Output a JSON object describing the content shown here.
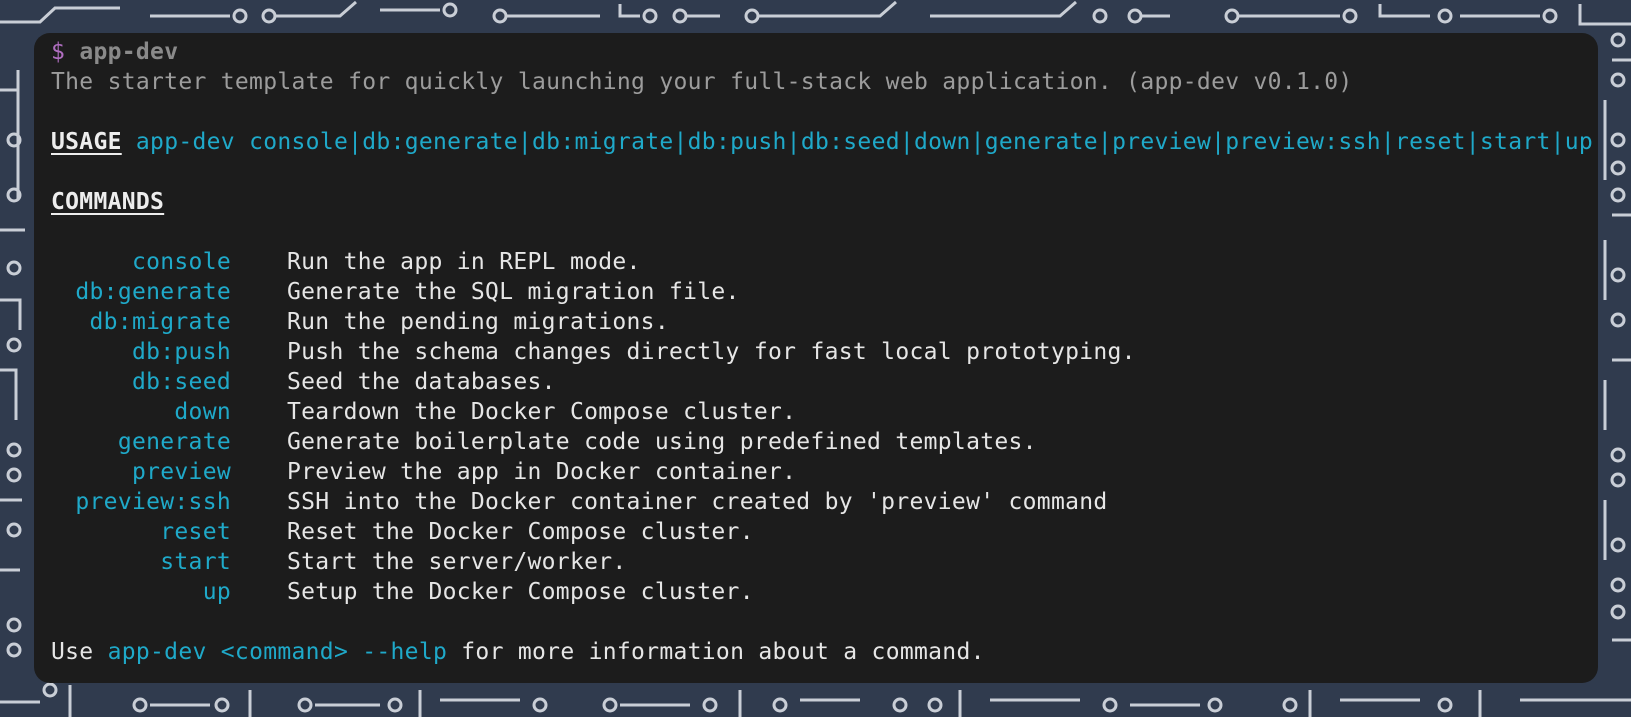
{
  "prompt": {
    "symbol": "$",
    "command": "app-dev"
  },
  "description": "The starter template for quickly launching your full-stack web application. (app-dev v0.1.0)",
  "usage": {
    "keyword": "USAGE",
    "binary": "app-dev",
    "subcommands": "console|db:generate|db:migrate|db:push|db:seed|down|generate|preview|preview:ssh|reset|start|up"
  },
  "commands": {
    "heading": "COMMANDS",
    "items": [
      {
        "name": "console",
        "desc": "Run the app in REPL mode."
      },
      {
        "name": "db:generate",
        "desc": "Generate the SQL migration file."
      },
      {
        "name": "db:migrate",
        "desc": "Run the pending migrations."
      },
      {
        "name": "db:push",
        "desc": "Push the schema changes directly for fast local prototyping."
      },
      {
        "name": "db:seed",
        "desc": "Seed the databases."
      },
      {
        "name": "down",
        "desc": "Teardown the Docker Compose cluster."
      },
      {
        "name": "generate",
        "desc": "Generate boilerplate code using predefined templates."
      },
      {
        "name": "preview",
        "desc": "Preview the app in Docker container."
      },
      {
        "name": "preview:ssh",
        "desc": "SSH into the Docker container created by 'preview' command"
      },
      {
        "name": "reset",
        "desc": "Reset the Docker Compose cluster."
      },
      {
        "name": "start",
        "desc": "Start the server/worker."
      },
      {
        "name": "up",
        "desc": "Setup the Docker Compose cluster."
      }
    ]
  },
  "footer": {
    "prefix": "Use ",
    "hint": "app-dev <command> --help",
    "suffix": " for more information about a command."
  },
  "colors": {
    "background": "#303b4e",
    "terminal": "#1c1c1c",
    "accent": "#1fa9c9",
    "prompt": "#b06ec0"
  }
}
